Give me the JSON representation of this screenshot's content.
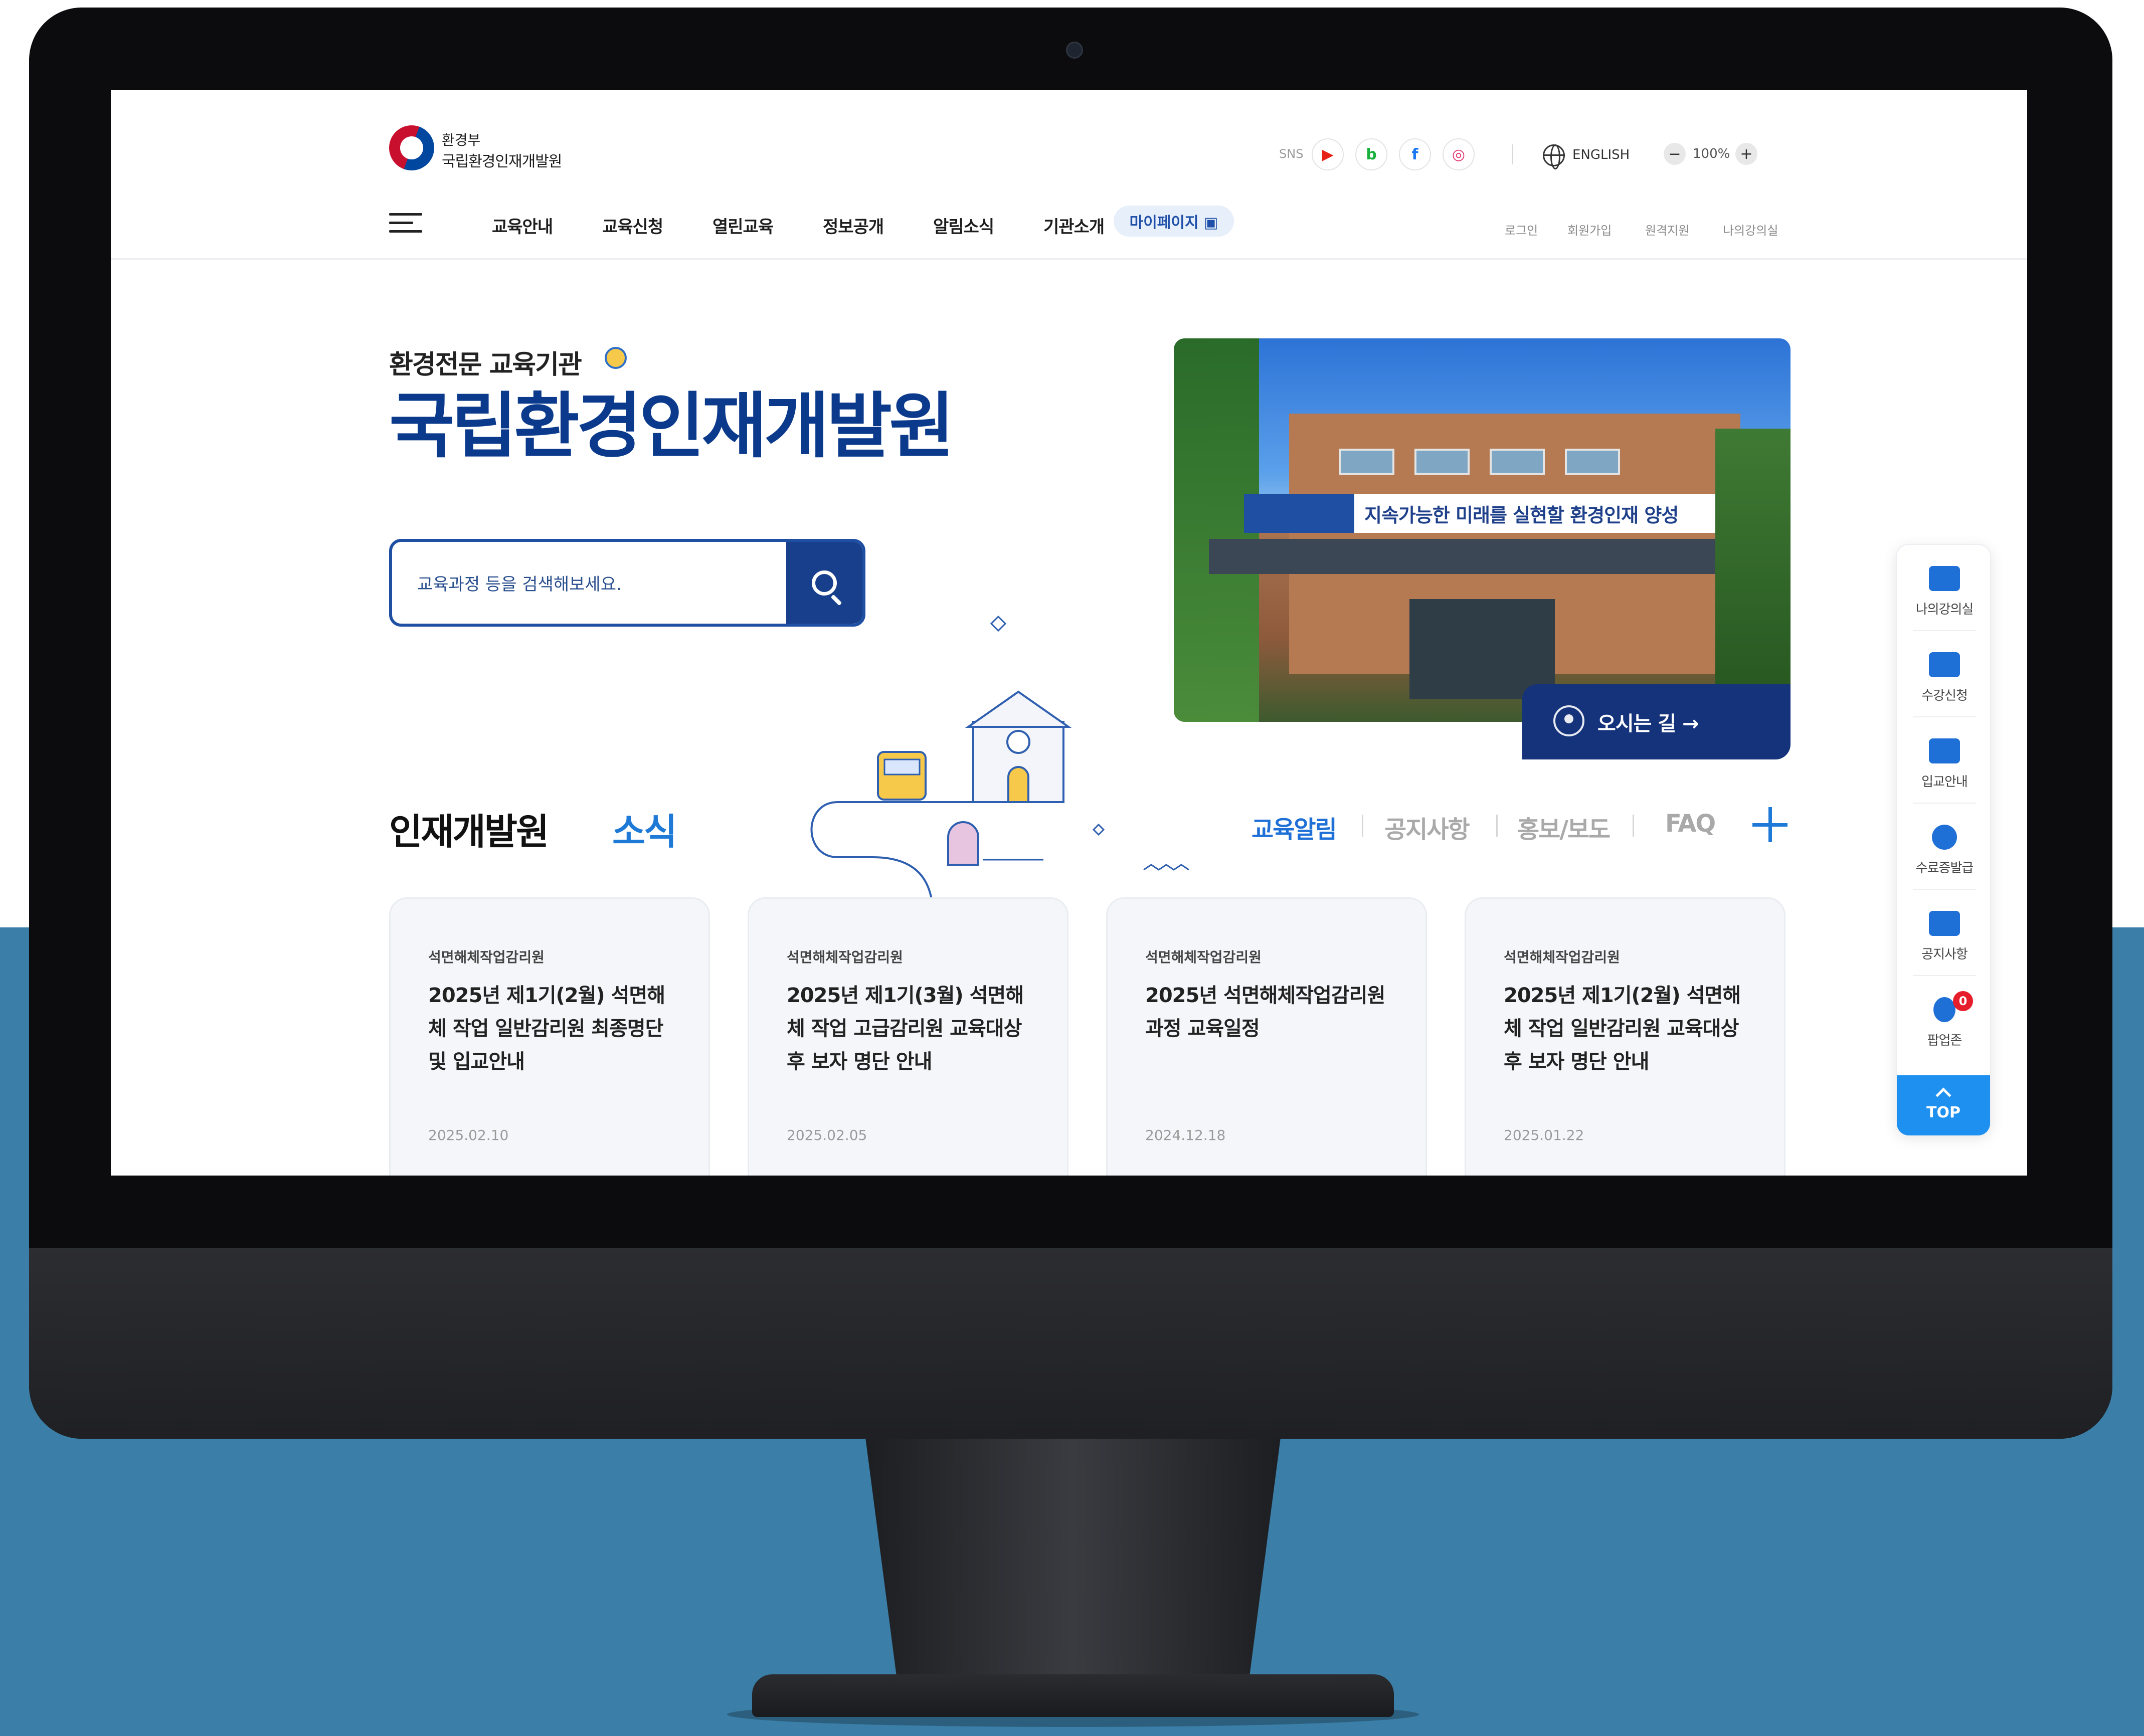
{
  "header": {
    "logo_line1": "환경부",
    "logo_line2": "국립환경인재개발원",
    "sns_label": "SNS",
    "sns_icons": [
      "youtube-icon",
      "blog-icon",
      "facebook-icon",
      "instagram-icon"
    ],
    "sns_glyphs": [
      "▶",
      "b",
      "f",
      "◎"
    ],
    "language": "ENGLISH",
    "zoom_minus": "−",
    "zoom_level": "100%",
    "zoom_plus": "+"
  },
  "nav": {
    "items": [
      "교육안내",
      "교육신청",
      "열린교육",
      "정보공개",
      "알림소식",
      "기관소개"
    ],
    "mypage": "마이페이지 ▣",
    "utility": [
      "로그인",
      "회원가입",
      "원격지원",
      "나의강의실"
    ]
  },
  "hero": {
    "kicker": "환경전문 교육기관",
    "title": "국립환경인재개발원",
    "search_placeholder": "교육과정 등을 검색해보세요.",
    "photo_banner": "지속가능한 미래를 실현할 환경인재 양성",
    "directions_label": "오시는 길 →"
  },
  "news": {
    "title": "인재개발원",
    "title_accent": "소식",
    "tabs": [
      "교육알림",
      "공지사항",
      "홍보/보도",
      "FAQ"
    ],
    "active_tab": 0,
    "cards": [
      {
        "category": "석면해체작업감리원",
        "title": "2025년 제1기(2월) 석면해체 작업 일반감리원 최종명단 및 입교안내",
        "date": "2025.02.10"
      },
      {
        "category": "석면해체작업감리원",
        "title": "2025년 제1기(3월) 석면해체 작업 고급감리원 교육대상 후 보자 명단 안내",
        "date": "2025.02.05"
      },
      {
        "category": "석면해체작업감리원",
        "title": "2025년 석면해체작업감리원 과정 교육일정",
        "date": "2024.12.18"
      },
      {
        "category": "석면해체작업감리원",
        "title": "2025년 제1기(2월) 석면해체 작업 일반감리원 교육대상 후 보자 명단 안내",
        "date": "2025.01.22"
      }
    ]
  },
  "quick_menu": {
    "items": [
      {
        "label": "나의강의실",
        "icon": "graduation-cap-icon"
      },
      {
        "label": "수강신청",
        "icon": "book-icon"
      },
      {
        "label": "입교안내",
        "icon": "school-icon"
      },
      {
        "label": "수료증발급",
        "icon": "medal-icon"
      },
      {
        "label": "공지사항",
        "icon": "speech-bubble-icon"
      },
      {
        "label": "팝업존",
        "icon": "lightbulb-icon"
      }
    ],
    "popup_badge": "0",
    "top_label": "TOP"
  },
  "colors": {
    "brand_navy": "#0b3a8c",
    "accent_blue": "#1e7ad6",
    "backdrop_blue": "#3b7fa8"
  }
}
